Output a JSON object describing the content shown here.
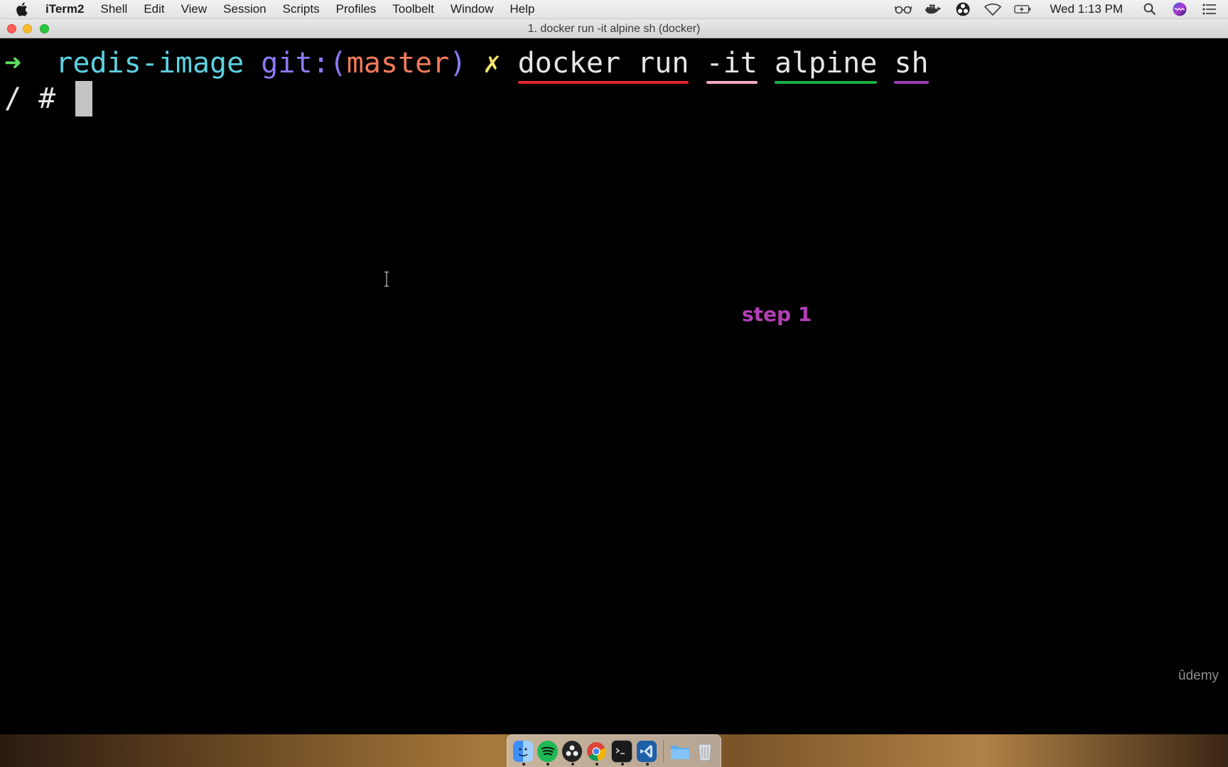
{
  "menubar": {
    "app_name": "iTerm2",
    "items": [
      "Shell",
      "Edit",
      "View",
      "Session",
      "Scripts",
      "Profiles",
      "Toolbelt",
      "Window",
      "Help"
    ],
    "clock": "Wed 1:13 PM"
  },
  "window": {
    "title": "1. docker run -it alpine sh (docker)"
  },
  "terminal": {
    "prompt_arrow": "➜",
    "directory": "redis-image",
    "git_prefix": "git:(",
    "branch": "master",
    "git_suffix": ")",
    "dirty_mark": "✗",
    "command_tokens": [
      {
        "text": "docker run",
        "underline_color": "#e3262b"
      },
      {
        "text": "-it",
        "underline_color": "#f4a9c4"
      },
      {
        "text": "alpine",
        "underline_color": "#1fae43"
      },
      {
        "text": "sh",
        "underline_color": "#9b3fb5"
      }
    ],
    "shell_prompt": "/ #"
  },
  "annotation": {
    "step_label": "step 1",
    "color": "#b43fb6"
  },
  "watermark": "ûdemy",
  "dock": {
    "apps": [
      "finder-icon",
      "spotify-icon",
      "obs-icon",
      "chrome-icon",
      "terminal-icon",
      "vscode-icon"
    ],
    "extras": [
      "folder-icon",
      "trash-icon"
    ]
  }
}
